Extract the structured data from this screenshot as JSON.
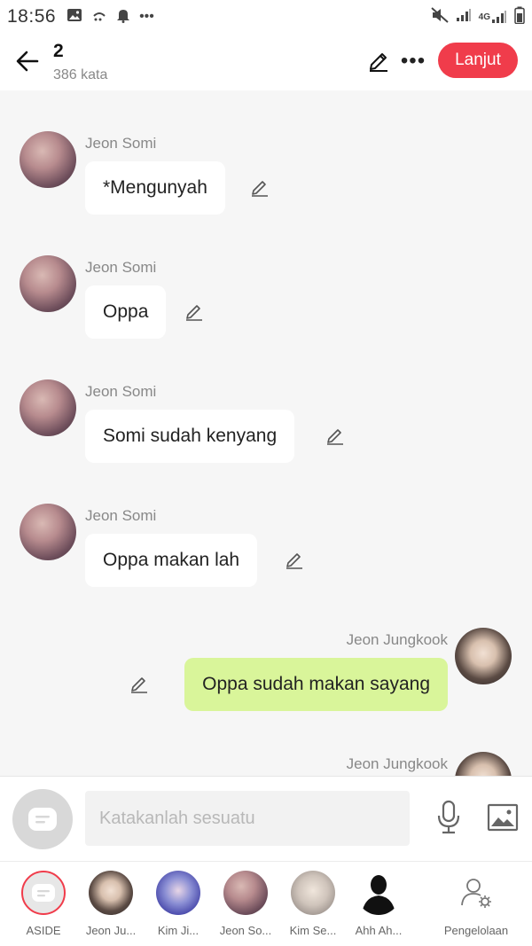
{
  "status_bar": {
    "time": "18:56",
    "network": "4G",
    "left_icons": [
      "image-icon",
      "drizzle-icon",
      "bell-icon",
      "more-dots-icon"
    ],
    "right_icons": [
      "mute-icon",
      "signal-icon",
      "signal-4g-icon",
      "battery-icon"
    ]
  },
  "header": {
    "title": "2",
    "subtitle": "386 kata",
    "next_label": "Lanjut"
  },
  "messages": [
    {
      "sender": "Jeon Somi",
      "text": "*Mengunyah",
      "side": "left"
    },
    {
      "sender": "Jeon Somi",
      "text": "Oppa",
      "side": "left"
    },
    {
      "sender": "Jeon Somi",
      "text": "Somi sudah kenyang",
      "side": "left"
    },
    {
      "sender": "Jeon Somi",
      "text": "Oppa makan lah",
      "side": "left"
    },
    {
      "sender": "Jeon Jungkook",
      "text": "Oppa sudah makan sayang",
      "side": "right"
    },
    {
      "sender": "Jeon Jungkook",
      "text": "",
      "side": "right"
    }
  ],
  "input": {
    "placeholder": "Katakanlah sesuatu"
  },
  "characters": [
    {
      "name": "ASIDE"
    },
    {
      "name": "Jeon Ju..."
    },
    {
      "name": "Kim Ji..."
    },
    {
      "name": "Jeon So..."
    },
    {
      "name": "Kim Se..."
    },
    {
      "name": "Ahh Ah..."
    },
    {
      "name": "Pengelolaan"
    }
  ],
  "colors": {
    "accent_red": "#f03c4b",
    "my_bubble": "#d9f59a",
    "other_bubble": "#ffffff",
    "background": "#f6f6f6"
  }
}
